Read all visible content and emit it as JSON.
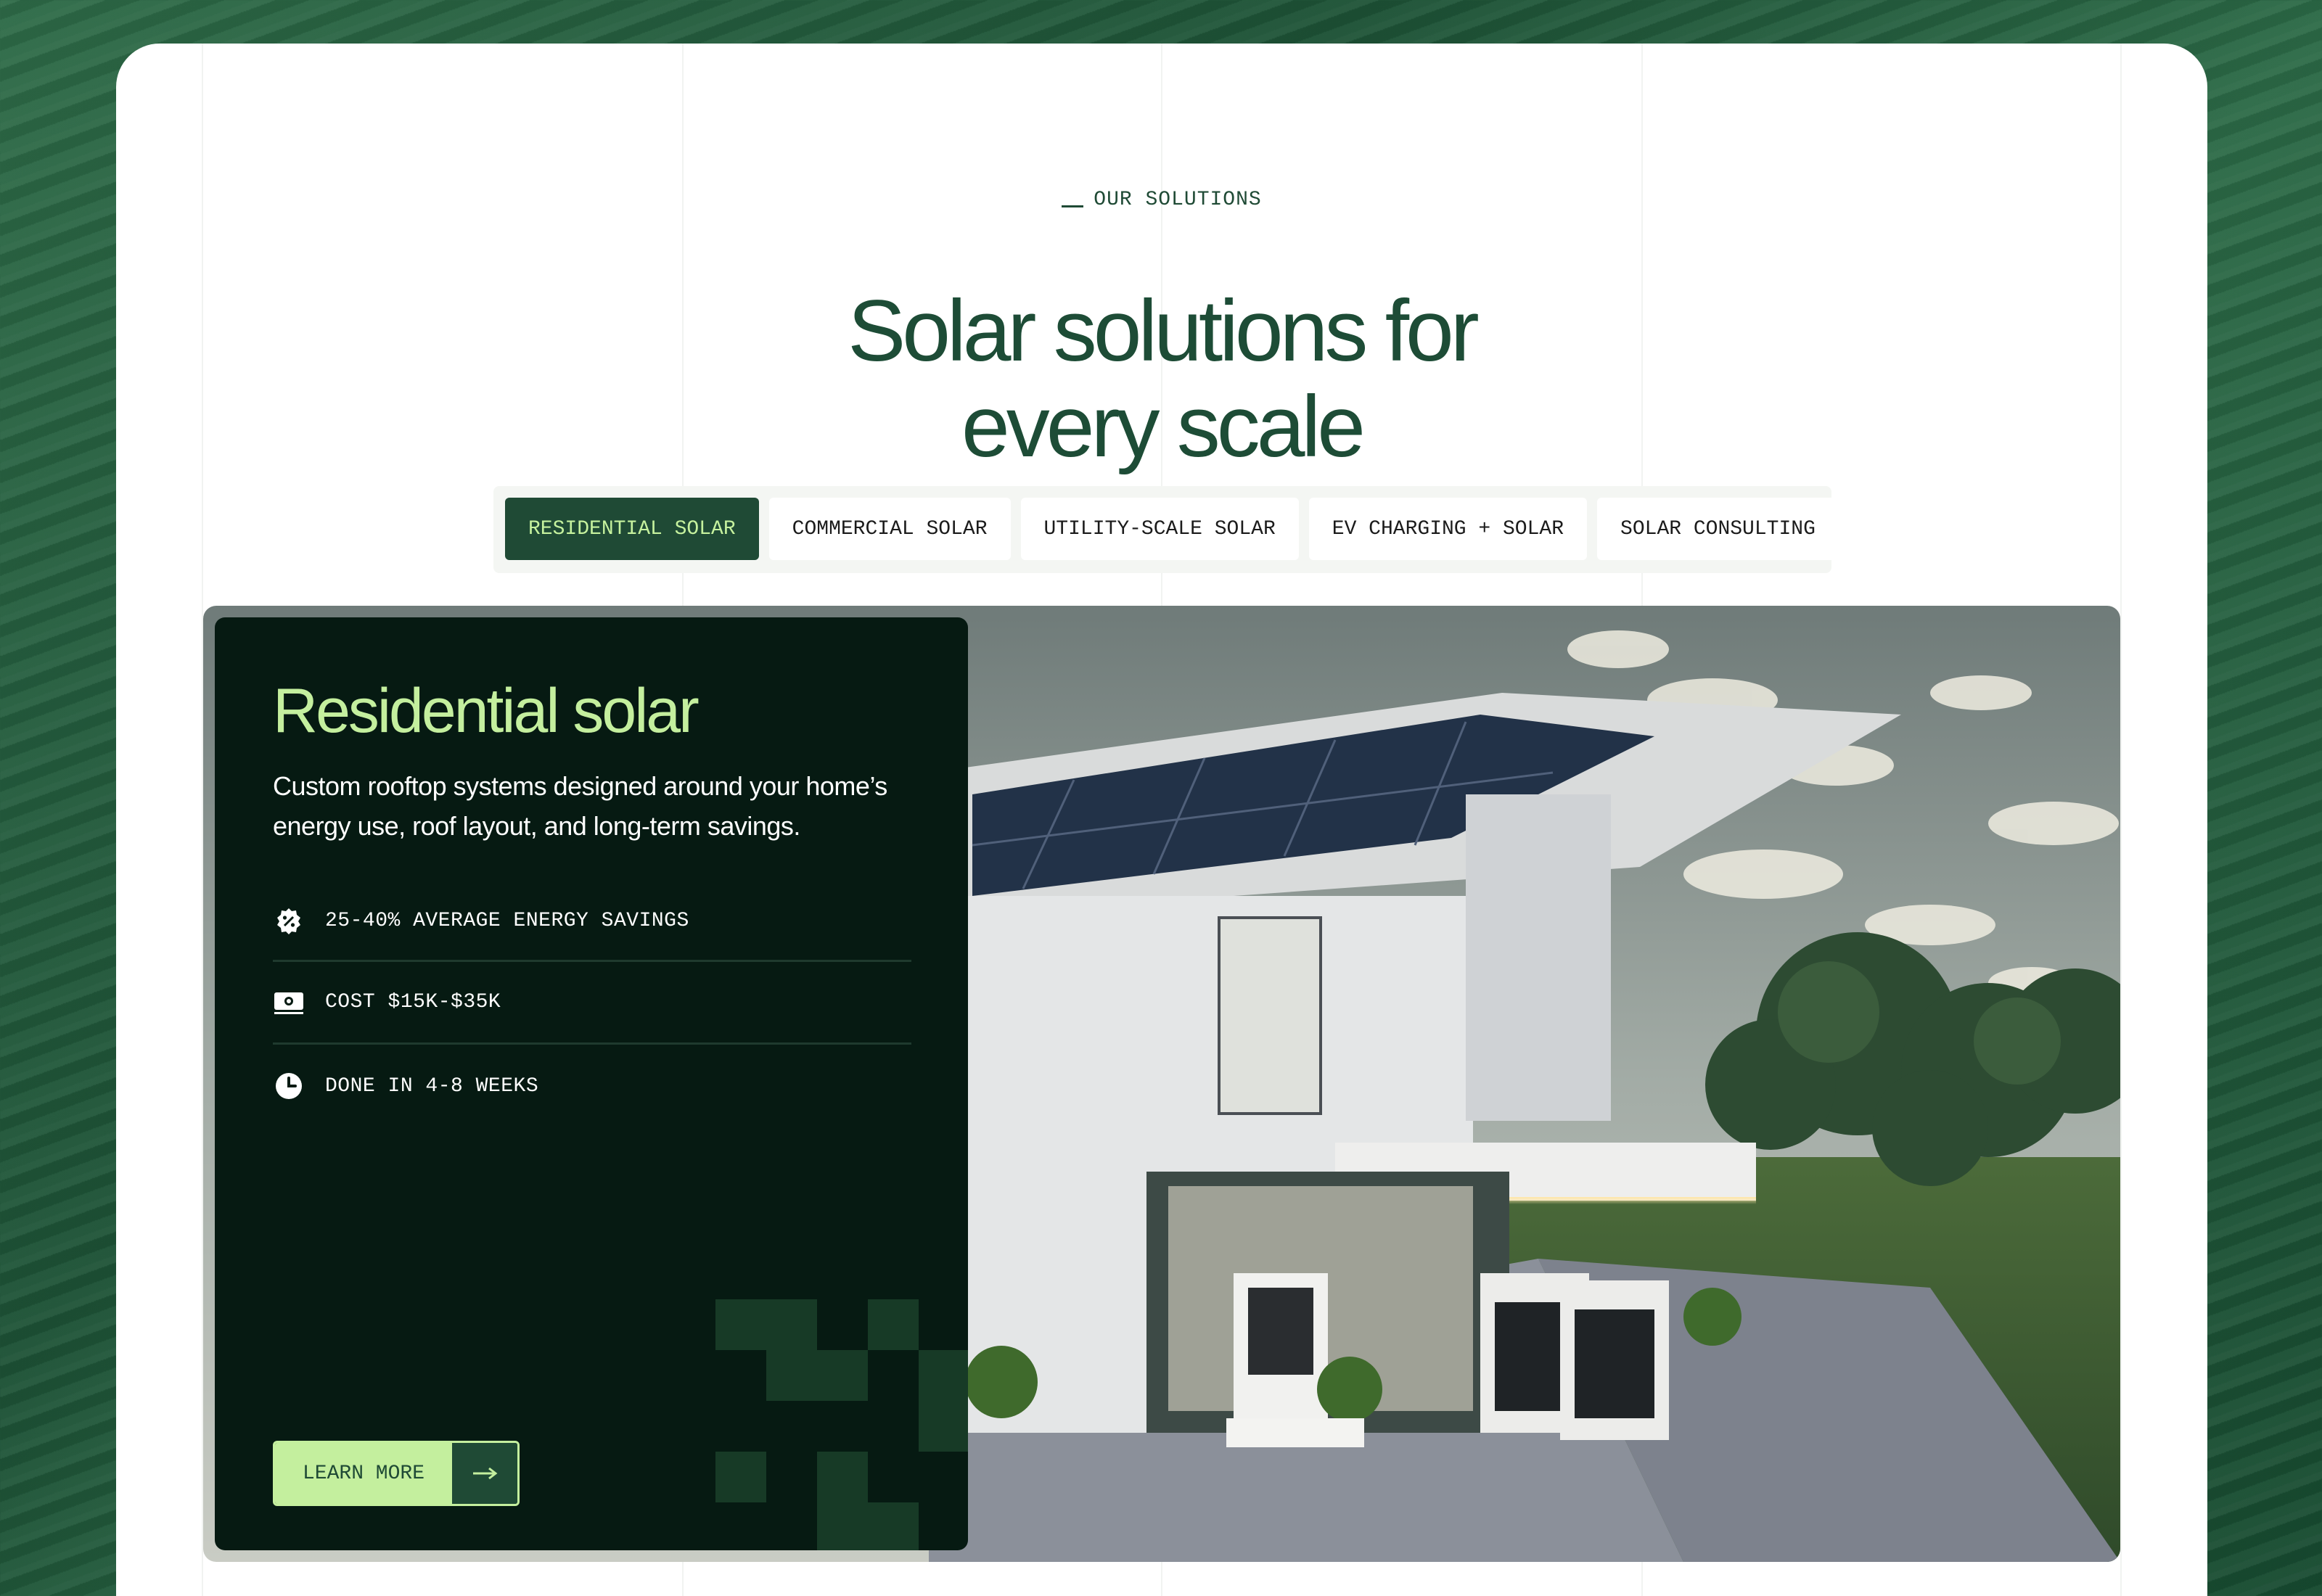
{
  "section": {
    "eyebrow": "OUR SOLUTIONS",
    "title_line1": "Solar solutions for",
    "title_line2": "every scale"
  },
  "tabs": [
    {
      "label": "RESIDENTIAL SOLAR",
      "active": true
    },
    {
      "label": "COMMERCIAL SOLAR",
      "active": false
    },
    {
      "label": "UTILITY-SCALE SOLAR",
      "active": false
    },
    {
      "label": "EV CHARGING + SOLAR",
      "active": false
    },
    {
      "label": "SOLAR CONSULTING",
      "active": false
    }
  ],
  "card": {
    "title": "Residential solar",
    "description": "Custom rooftop systems designed around your home’s energy use, roof layout, and long-term savings.",
    "features": [
      {
        "icon": "percent-badge-icon",
        "text": "25-40% AVERAGE ENERGY SAVINGS"
      },
      {
        "icon": "money-bill-icon",
        "text": "COST $15K-$35K"
      },
      {
        "icon": "clock-icon",
        "text": "DONE IN 4-8 WEEKS"
      }
    ],
    "button": {
      "label": "LEARN MORE",
      "icon": "arrow-right-icon"
    }
  },
  "colors": {
    "brand_dark": "#1f4a35",
    "accent_lime": "#c4ef9e",
    "card_bg": "#061a12"
  }
}
